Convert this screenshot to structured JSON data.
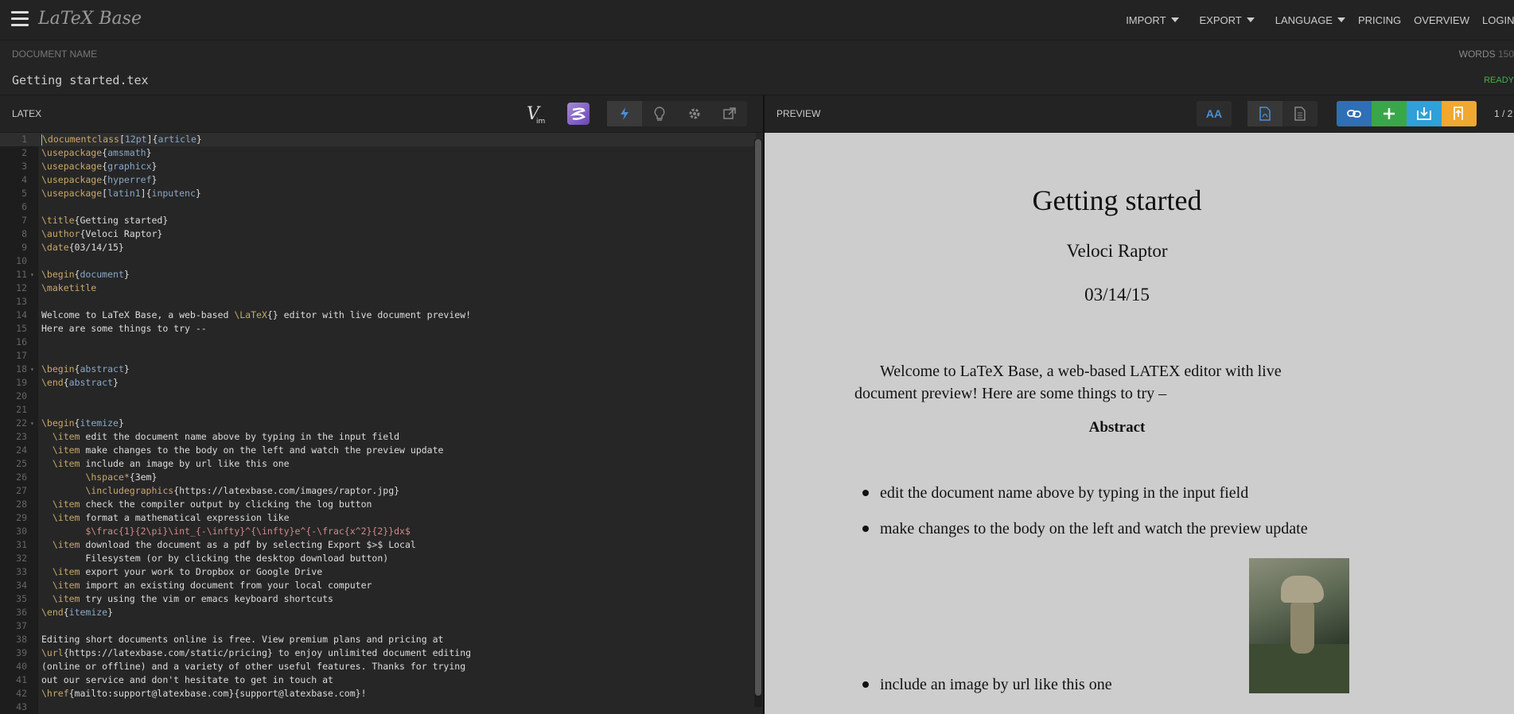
{
  "app": {
    "brand": "LaTeX Base"
  },
  "nav": {
    "import": "IMPORT",
    "export": "EXPORT",
    "language": "LANGUAGE",
    "pricing": "PRICING",
    "overview": "OVERVIEW",
    "login": "LOGIN"
  },
  "doc": {
    "label": "DOCUMENT NAME",
    "name": "Getting started.tex",
    "words_label": "WORDS",
    "words_count": "150",
    "status": "READY"
  },
  "editor": {
    "title": "LATEX",
    "lines": [
      {
        "n": "1",
        "t": "\\documentclass[12pt]{article}"
      },
      {
        "n": "2",
        "t": "\\usepackage{amsmath}"
      },
      {
        "n": "3",
        "t": "\\usepackage{graphicx}"
      },
      {
        "n": "4",
        "t": "\\usepackage{hyperref}"
      },
      {
        "n": "5",
        "t": "\\usepackage[latin1]{inputenc}"
      },
      {
        "n": "6",
        "t": ""
      },
      {
        "n": "7",
        "t": "\\title{Getting started}"
      },
      {
        "n": "8",
        "t": "\\author{Veloci Raptor}"
      },
      {
        "n": "9",
        "t": "\\date{03/14/15}"
      },
      {
        "n": "10",
        "t": ""
      },
      {
        "n": "11",
        "t": "\\begin{document}"
      },
      {
        "n": "12",
        "t": "\\maketitle"
      },
      {
        "n": "13",
        "t": ""
      },
      {
        "n": "14",
        "t": "Welcome to LaTeX Base, a web-based \\LaTeX{} editor with live document preview!"
      },
      {
        "n": "15",
        "t": "Here are some things to try --"
      },
      {
        "n": "16",
        "t": ""
      },
      {
        "n": "17",
        "t": ""
      },
      {
        "n": "18",
        "t": "\\begin{abstract}"
      },
      {
        "n": "19",
        "t": "\\end{abstract}"
      },
      {
        "n": "20",
        "t": ""
      },
      {
        "n": "21",
        "t": ""
      },
      {
        "n": "22",
        "t": "\\begin{itemize}"
      },
      {
        "n": "23",
        "t": "  \\item edit the document name above by typing in the input field"
      },
      {
        "n": "24",
        "t": "  \\item make changes to the body on the left and watch the preview update"
      },
      {
        "n": "25",
        "t": "  \\item include an image by url like this one"
      },
      {
        "n": "26",
        "t": "        \\hspace*{3em}"
      },
      {
        "n": "27",
        "t": "        \\includegraphics{https://latexbase.com/images/raptor.jpg}"
      },
      {
        "n": "28",
        "t": "  \\item check the compiler output by clicking the log button"
      },
      {
        "n": "29",
        "t": "  \\item format a mathematical expression like"
      },
      {
        "n": "30",
        "t": "        $\\frac{1}{2\\pi}\\int_{-\\infty}^{\\infty}e^{-\\frac{x^2}{2}}dx$"
      },
      {
        "n": "31",
        "t": "  \\item download the document as a pdf by selecting Export $>$ Local"
      },
      {
        "n": "32",
        "t": "        Filesystem (or by clicking the desktop download button)"
      },
      {
        "n": "33",
        "t": "  \\item export your work to Dropbox or Google Drive"
      },
      {
        "n": "34",
        "t": "  \\item import an existing document from your local computer"
      },
      {
        "n": "35",
        "t": "  \\item try using the vim or emacs keyboard shortcuts"
      },
      {
        "n": "36",
        "t": "\\end{itemize}"
      },
      {
        "n": "37",
        "t": ""
      },
      {
        "n": "38",
        "t": "Editing short documents online is free. View premium plans and pricing at"
      },
      {
        "n": "39",
        "t": "\\url{https://latexbase.com/static/pricing} to enjoy unlimited document editing"
      },
      {
        "n": "40",
        "t": "(online or offline) and a variety of other useful features. Thanks for trying"
      },
      {
        "n": "41",
        "t": "out our service and don't hesitate to get in touch at"
      },
      {
        "n": "42",
        "t": "\\href{mailto:support@latexbase.com}{support@latexbase.com}!"
      },
      {
        "n": "43",
        "t": ""
      }
    ]
  },
  "preview": {
    "title": "PREVIEW",
    "font_button": "AA",
    "page": "1 / 2",
    "doc_title": "Getting started",
    "doc_author": "Veloci Raptor",
    "doc_date": "03/14/15",
    "body": "Welcome to LaTeX Base, a web-based LATEX editor with live document preview! Here are some things to try –",
    "abstract": "Abstract",
    "items": [
      "edit the document name above by typing in the input field",
      "make changes to the body on the left and watch the preview update",
      "include an image by url like this one"
    ]
  },
  "colors": {
    "link": "#2f6fb5",
    "add": "#3aa64a",
    "download": "#2fa0d8",
    "upload": "#f0a830",
    "ready": "#3cb34a"
  }
}
